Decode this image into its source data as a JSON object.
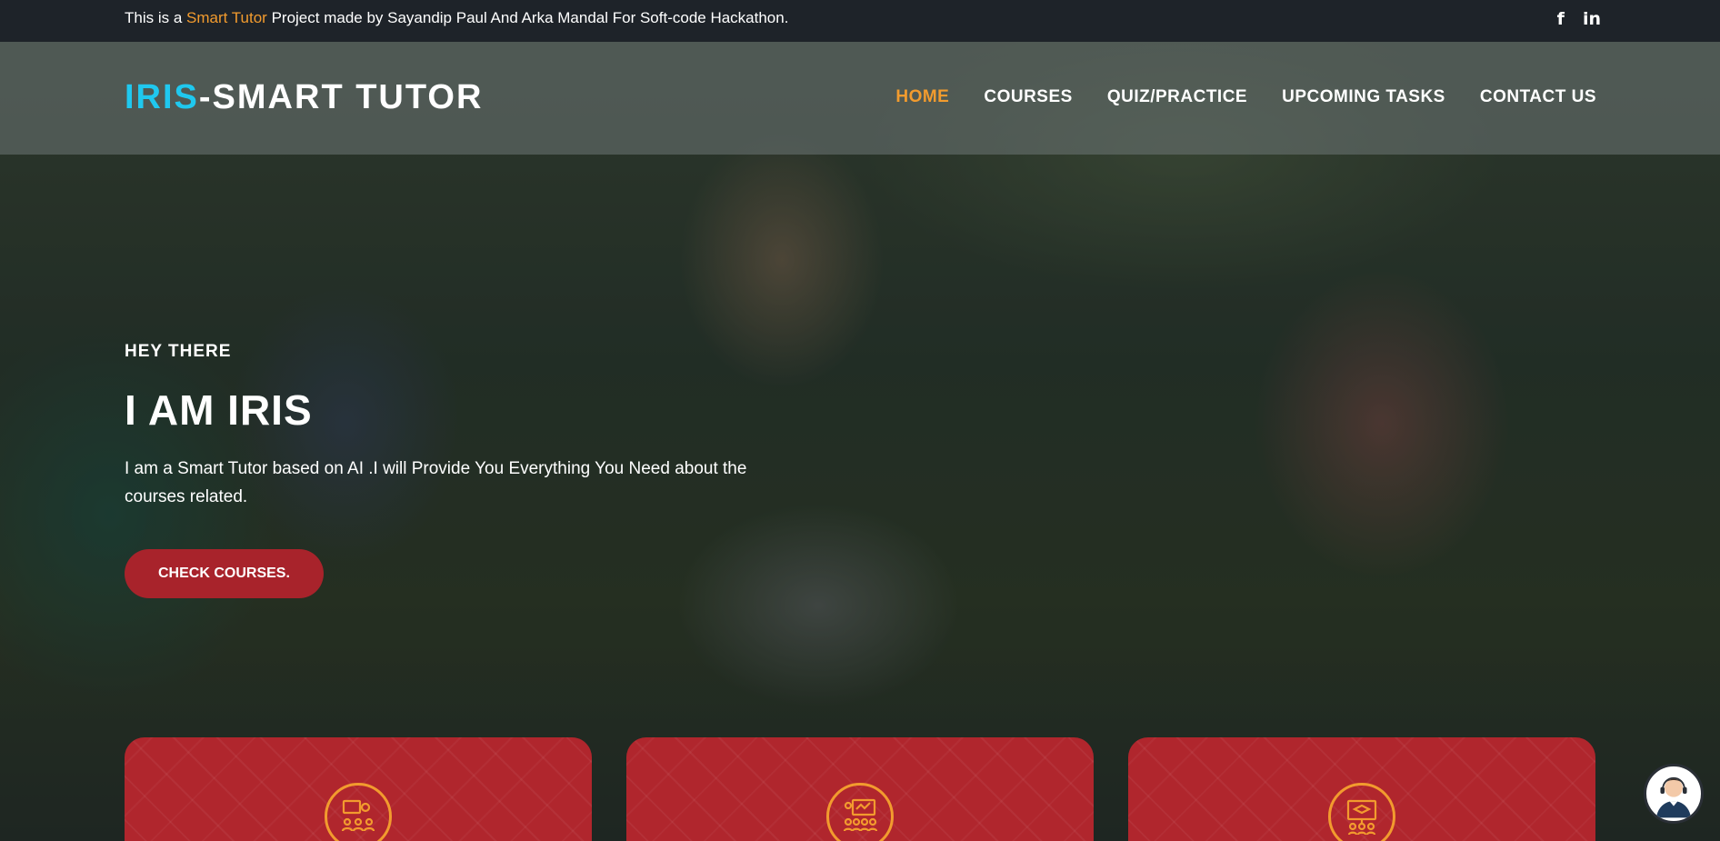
{
  "topbar": {
    "notice_prefix": "This is a ",
    "notice_accent": "Smart Tutor",
    "notice_suffix": " Project made by Sayandip Paul And Arka Mandal For Soft-code Hackathon.",
    "social": [
      {
        "icon": "facebook-icon",
        "glyph": "f"
      },
      {
        "icon": "linkedin-icon",
        "glyph": "in"
      }
    ]
  },
  "brand": {
    "accent_part": "IRIS",
    "rest": "-SMART TUTOR"
  },
  "nav": {
    "items": [
      "HOME",
      "COURSES",
      "QUIZ/PRACTICE",
      "UPCOMING TASKS",
      "CONTACT US"
    ],
    "active": "HOME"
  },
  "hero": {
    "eyebrow": "HEY THERE",
    "headline": "I AM IRIS",
    "description": "I am a Smart Tutor based on AI .I will Provide You Everything You Need about the courses related.",
    "cta_label": "CHECK COURSES."
  },
  "cards": [
    {
      "icon": "classroom-group-icon"
    },
    {
      "icon": "presentation-board-icon"
    },
    {
      "icon": "graduation-lecture-icon"
    }
  ],
  "chatbot": {
    "icon": "support-agent-avatar-icon"
  },
  "colors": {
    "accent_orange": "#f29b2e",
    "brand_cyan": "#1fc8ef",
    "card_red": "#b0262d",
    "cta_red": "#a8232b",
    "topbar_bg": "#1e2329"
  }
}
